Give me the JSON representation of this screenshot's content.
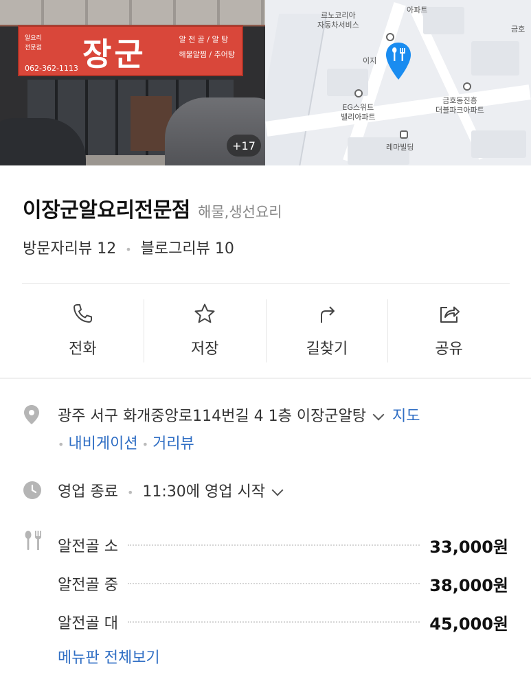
{
  "photo": {
    "sign_main": "장군",
    "sign_small": [
      "알요리",
      "전문점"
    ],
    "sign_phone": "062-362-1113",
    "sign_right": [
      "알 전 골 / 알 탕",
      "해물알찜 / 추어탕"
    ],
    "more_count": "+17"
  },
  "map": {
    "labels": {
      "renault": "르노코리아\n자동차서비스",
      "top_apt": "아파트",
      "eg": "EG스위트\n밸리아파트",
      "geumho": "금호동진흥\n더블파크아파트",
      "rema": "레마빌딩",
      "iji": "이지",
      "top_right": "금호"
    }
  },
  "place": {
    "name": "이장군알요리전문점",
    "category": "해물,생선요리",
    "visitor_reviews": "방문자리뷰 12",
    "blog_reviews": "블로그리뷰 10"
  },
  "actions": [
    {
      "label": "전화",
      "icon": "phone-icon"
    },
    {
      "label": "저장",
      "icon": "star-icon"
    },
    {
      "label": "길찾기",
      "icon": "directions-icon"
    },
    {
      "label": "공유",
      "icon": "share-icon"
    }
  ],
  "address": {
    "text": "광주 서구 화개중앙로114번길 4 1층 이장군알탕",
    "map_link": "지도",
    "navigation_link": "내비게이션",
    "street_view_link": "거리뷰"
  },
  "hours": {
    "status": "영업 종료",
    "next": "11:30에 영업 시작"
  },
  "menu": {
    "items": [
      {
        "name": "알전골 소",
        "price": "33,000원"
      },
      {
        "name": "알전골 중",
        "price": "38,000원"
      },
      {
        "name": "알전골 대",
        "price": "45,000원"
      }
    ],
    "more_label": "메뉴판 전체보기"
  },
  "colors": {
    "link": "#2f6ec4",
    "pin": "#1a8cf0",
    "sign": "#d9473a"
  }
}
